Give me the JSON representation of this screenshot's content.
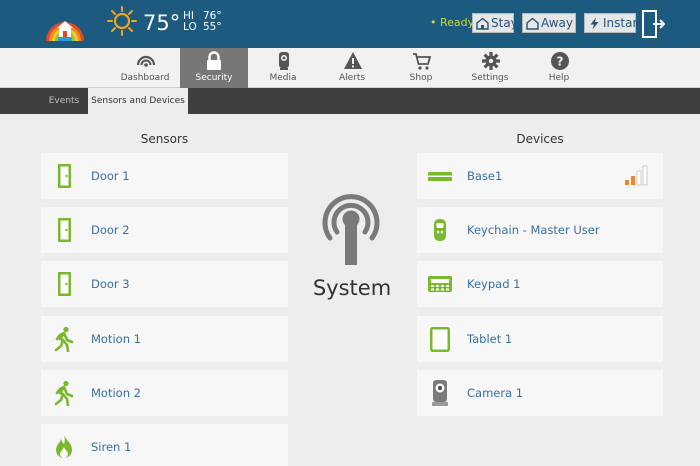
{
  "weather": {
    "temp": "75°",
    "hi_label": "HI",
    "hi": "76°",
    "lo_label": "LO",
    "lo": "55°"
  },
  "status": {
    "text": "• Ready"
  },
  "arm": {
    "stay": "Stay",
    "away": "Away",
    "instant": "Instant"
  },
  "nav": {
    "items": [
      {
        "label": "Dashboard",
        "icon": "dashboard-icon"
      },
      {
        "label": "Security",
        "icon": "lock-icon",
        "active": true
      },
      {
        "label": "Media",
        "icon": "camera-icon"
      },
      {
        "label": "Alerts",
        "icon": "warning-icon"
      },
      {
        "label": "Shop",
        "icon": "cart-icon"
      },
      {
        "label": "Settings",
        "icon": "gear-icon"
      },
      {
        "label": "Help",
        "icon": "help-icon"
      }
    ]
  },
  "subnav": {
    "tabs": [
      {
        "label": "Events"
      },
      {
        "label": "Sensors and Devices",
        "active": true
      }
    ]
  },
  "sensors": {
    "title": "Sensors",
    "items": [
      {
        "label": "Door 1",
        "icon": "door-icon"
      },
      {
        "label": "Door 2",
        "icon": "door-icon"
      },
      {
        "label": "Door 3",
        "icon": "door-icon"
      },
      {
        "label": "Motion 1",
        "icon": "motion-icon"
      },
      {
        "label": "Motion 2",
        "icon": "motion-icon"
      },
      {
        "label": "Siren 1",
        "icon": "flame-icon"
      }
    ]
  },
  "system": {
    "label": "System",
    "icon": "system-icon"
  },
  "devices": {
    "title": "Devices",
    "items": [
      {
        "label": "Base1",
        "icon": "base-station-icon"
      },
      {
        "label": "Keychain - Master User",
        "icon": "keychain-icon"
      },
      {
        "label": "Keypad 1",
        "icon": "keypad-icon"
      },
      {
        "label": "Tablet 1",
        "icon": "tablet-icon"
      },
      {
        "label": "Camera 1",
        "icon": "camera-device-icon"
      }
    ]
  },
  "colors": {
    "topbar": "#1c5a80",
    "accent_green": "#7ab82e",
    "link_blue": "#3a6fa0",
    "ready_green": "#c4d93b",
    "signal_orange": "#f0862a"
  }
}
